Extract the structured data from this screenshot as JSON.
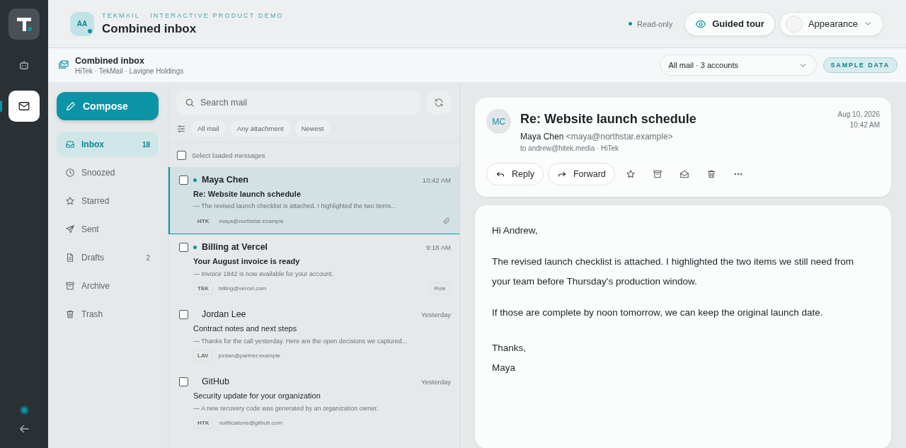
{
  "rail": {
    "items": [
      {
        "kind": "bot",
        "selected": false
      },
      {
        "kind": "mail",
        "selected": true
      }
    ],
    "online": true
  },
  "header": {
    "avatar": "AA",
    "eyebrow": "TEKMAIL · INTERACTIVE PRODUCT DEMO",
    "title": "Combined inbox",
    "status": "Read-only",
    "tour_button": "Guided tour",
    "appearance_button": "Appearance"
  },
  "subbar": {
    "title": "Combined inbox",
    "accounts": "HiTek · TekMail · Lavigne Holdings",
    "scope": "All mail · 3 accounts",
    "badge": "SAMPLE DATA"
  },
  "compose": "Compose",
  "folders": [
    {
      "kind": "inbox",
      "label": "Inbox",
      "count": "18",
      "selected": true
    },
    {
      "kind": "clock",
      "label": "Snoozed",
      "selected": false
    },
    {
      "kind": "star",
      "label": "Starred",
      "selected": false
    },
    {
      "kind": "send",
      "label": "Sent",
      "selected": false
    },
    {
      "kind": "doc",
      "label": "Drafts",
      "count": "2",
      "selected": false
    },
    {
      "kind": "archive",
      "label": "Archive",
      "selected": false
    },
    {
      "kind": "trash",
      "label": "Trash",
      "selected": false
    }
  ],
  "search": {
    "placeholder": "Search mail"
  },
  "filters": [
    "All mail",
    "Any attachment",
    "Newest"
  ],
  "select_all": {
    "label": "Select loaded messages",
    "checked": false
  },
  "messages": [
    {
      "sender": "Maya Chen",
      "time": "10:42 AM",
      "subject": "Re: Website launch schedule",
      "preview": "— The revised launch checklist is attached. I highlighted the two items...",
      "account": "HTK",
      "address": "maya@northstar.example",
      "unread": true,
      "selected": true,
      "checked": false,
      "attachment": true
    },
    {
      "sender": "Billing at Vercel",
      "time": "9:18 AM",
      "subject": "Your August invoice is ready",
      "preview": "— Invoice 1842 is now available for your account.",
      "account": "TEK",
      "address": "billing@vercel.com",
      "tag": "Rule",
      "unread": true,
      "selected": false,
      "checked": false,
      "attachment": false
    },
    {
      "sender": "Jordan Lee",
      "time": "Yesterday",
      "subject": "Contract notes and next steps",
      "preview": "— Thanks for the call yesterday. Here are the open decisions we captured...",
      "account": "LAV",
      "address": "jordan@partner.example",
      "unread": false,
      "selected": false,
      "checked": false,
      "attachment": false
    },
    {
      "sender": "GitHub",
      "time": "Yesterday",
      "subject": "Security update for your organization",
      "preview": "— A new recovery code was generated by an organization owner.",
      "account": "HTK",
      "address": "notifications@github.com",
      "unread": false,
      "selected": false,
      "checked": false,
      "attachment": false
    }
  ],
  "reader": {
    "avatar": "MC",
    "subject": "Re: Website launch schedule",
    "from_name": "Maya Chen",
    "from_address": "<maya@northstar.example>",
    "to": "to andrew@hitek.media · HiTek",
    "date": "Aug 10, 2026",
    "time": "10:42 AM",
    "actions": [
      {
        "kind": "reply",
        "label": "Reply"
      },
      {
        "kind": "forward",
        "label": "Forward"
      },
      {
        "kind": "star"
      },
      {
        "kind": "archive"
      },
      {
        "kind": "envelope"
      },
      {
        "kind": "trash"
      },
      {
        "kind": "more"
      }
    ],
    "body": [
      "Hi Andrew,",
      "The revised launch checklist is attached. I highlighted the two items we still need from your team before Thursday's production window.",
      "If those are complete by noon tomorrow, we can keep the original launch date."
    ],
    "signoff": [
      "Thanks,",
      "Maya"
    ]
  }
}
